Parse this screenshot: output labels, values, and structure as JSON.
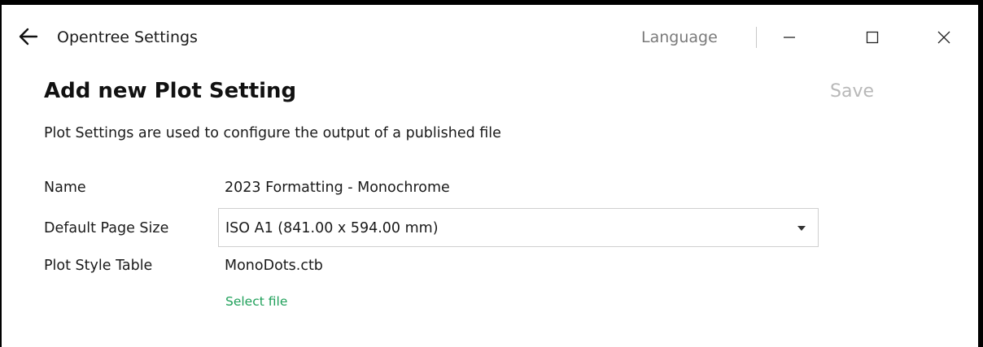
{
  "window": {
    "title": "Opentree Settings",
    "language_label": "Language"
  },
  "toolbar": {
    "save_label": "Save"
  },
  "page": {
    "title": "Add new Plot Setting",
    "description": "Plot Settings are used to configure the output of a published file"
  },
  "form": {
    "name_label": "Name",
    "name_value": "2023 Formatting - Monochrome",
    "page_size_label": "Default Page Size",
    "page_size_value": "ISO A1 (841.00 x 594.00 mm)",
    "plot_style_label": "Plot Style Table",
    "plot_style_value": "MonoDots.ctb",
    "select_file_label": "Select file"
  },
  "colors": {
    "accent_link": "#1fa05a",
    "disabled_text": "#b8b8b8",
    "muted_text": "#7a7a7a"
  },
  "icons": {
    "back": "arrow-left-icon",
    "minimize": "minimize-icon",
    "maximize": "maximize-icon",
    "close": "close-icon",
    "dropdown": "caret-down-icon"
  }
}
